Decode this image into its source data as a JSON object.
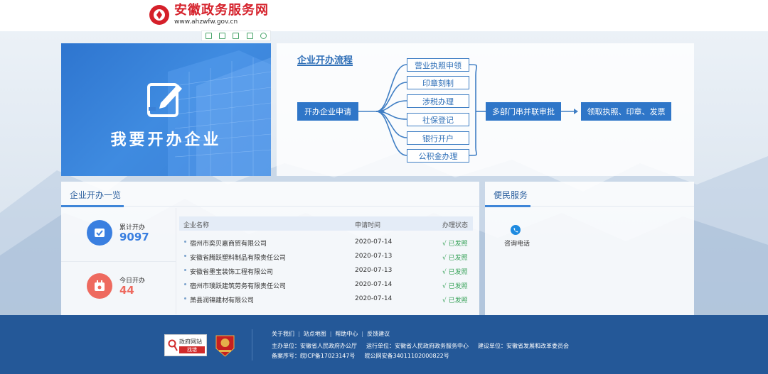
{
  "header": {
    "site_title": "安徽政务服务网",
    "site_url": "www.ahzwfw.gov.cn",
    "toolbar_icons": [
      "save-icon",
      "expand-icon",
      "screenshot-icon",
      "share-icon",
      "settings-icon"
    ]
  },
  "banner": {
    "title": "我要开办企业",
    "icon": "edit-document-icon"
  },
  "process": {
    "title": "企业开办流程",
    "start": "开办企业申请",
    "steps": [
      "营业执照申领",
      "印章刻制",
      "涉税办理",
      "社保登记",
      "银行开户",
      "公积金办理"
    ],
    "approval": "多部门串并联审批",
    "finish": "领取执照、印章、发票"
  },
  "overview": {
    "title": "企业开办一览",
    "total_label": "累计开办",
    "total_value": "9097",
    "today_label": "今日开办",
    "today_value": "44",
    "columns": [
      "企业名称",
      "申请时间",
      "办理状态"
    ],
    "rows": [
      {
        "name": "宿州市奕贝嘉商贸有限公司",
        "date": "2020-07-14",
        "status": "√ 已发照"
      },
      {
        "name": "安徽省腾跃塑料制品有限责任公司",
        "date": "2020-07-13",
        "status": "√ 已发照"
      },
      {
        "name": "安徽省墨宝装饰工程有限公司",
        "date": "2020-07-13",
        "status": "√ 已发照"
      },
      {
        "name": "宿州市璞跃建筑劳务有限责任公司",
        "date": "2020-07-14",
        "status": "√ 已发照"
      },
      {
        "name": "萧县润锦建材有限公司",
        "date": "2020-07-14",
        "status": "√ 已发照"
      }
    ]
  },
  "service": {
    "title": "便民服务",
    "phone_label": "咨询电话"
  },
  "footer": {
    "badge_text": "政府网站",
    "badge_button": "找错",
    "links": [
      "关于我们",
      "站点地图",
      "帮助中心",
      "反馈建议"
    ],
    "host": "主办单位：安徽省人民政府办公厅",
    "operator": "运行单位：安徽省人民政府政务服务中心",
    "builder": "建设单位：安徽省发展和改革委员会",
    "icp": "备案序号：皖ICP备17023147号",
    "police": "皖公网安备34011102000822号"
  },
  "colors": {
    "brand_red": "#d5202a",
    "primary_blue": "#2f76c8",
    "footer_blue": "#245898",
    "status_green": "#3aa35b",
    "total_circle": "#3a7fe0",
    "today_circle": "#ee6a5f"
  }
}
